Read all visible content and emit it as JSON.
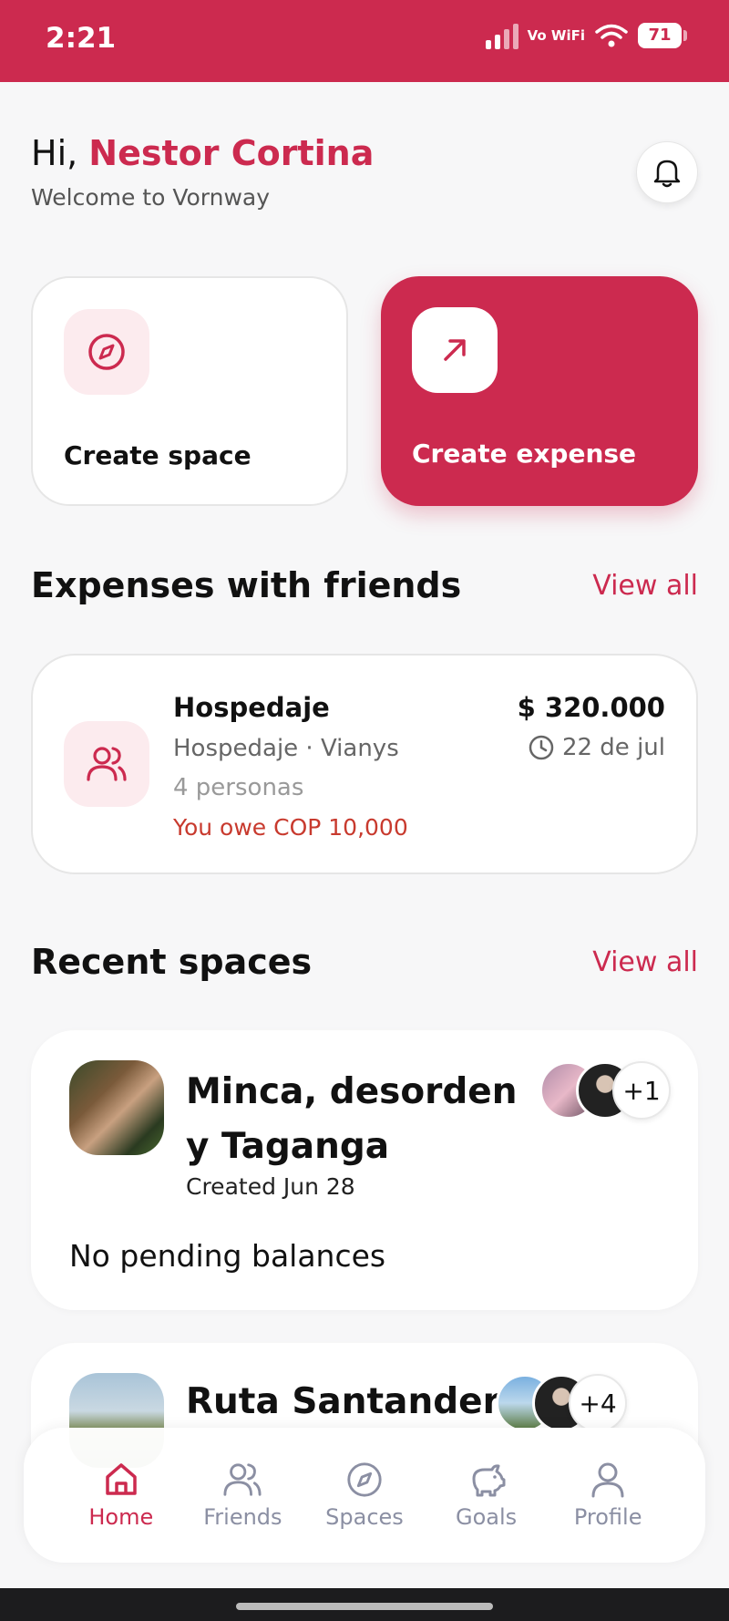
{
  "status_bar": {
    "time": "2:21",
    "network_label": "Vo WiFi",
    "battery": "71"
  },
  "header": {
    "greeting_prefix": "Hi, ",
    "user_name": "Nestor Cortina",
    "welcome": "Welcome to Vornway"
  },
  "actions": {
    "create_space": "Create space",
    "create_expense": "Create expense"
  },
  "expenses_section": {
    "title": "Expenses with friends",
    "view_all": "View all",
    "items": [
      {
        "title": "Hospedaje",
        "subtitle": "Hospedaje · Vianys",
        "people": "4 personas",
        "owe": "You owe COP 10,000",
        "amount": "$ 320.000",
        "date": "22 de jul"
      }
    ]
  },
  "spaces_section": {
    "title": "Recent spaces",
    "view_all": "View all",
    "items": [
      {
        "title": "Minca, desorden y Taganga",
        "created": "Created Jun 28",
        "balance": "No pending balances",
        "extra_members": "+1"
      },
      {
        "title": "Ruta Santander",
        "extra_members": "+4"
      }
    ]
  },
  "nav": {
    "items": [
      {
        "label": "Home",
        "icon": "home-icon",
        "active": true
      },
      {
        "label": "Friends",
        "icon": "friends-icon"
      },
      {
        "label": "Spaces",
        "icon": "compass-icon"
      },
      {
        "label": "Goals",
        "icon": "piggy-bank-icon"
      },
      {
        "label": "Profile",
        "icon": "profile-icon"
      }
    ]
  },
  "colors": {
    "accent": "#cc2a4f",
    "owe": "#c83a2e",
    "nav_inactive": "#8b8fa3"
  }
}
